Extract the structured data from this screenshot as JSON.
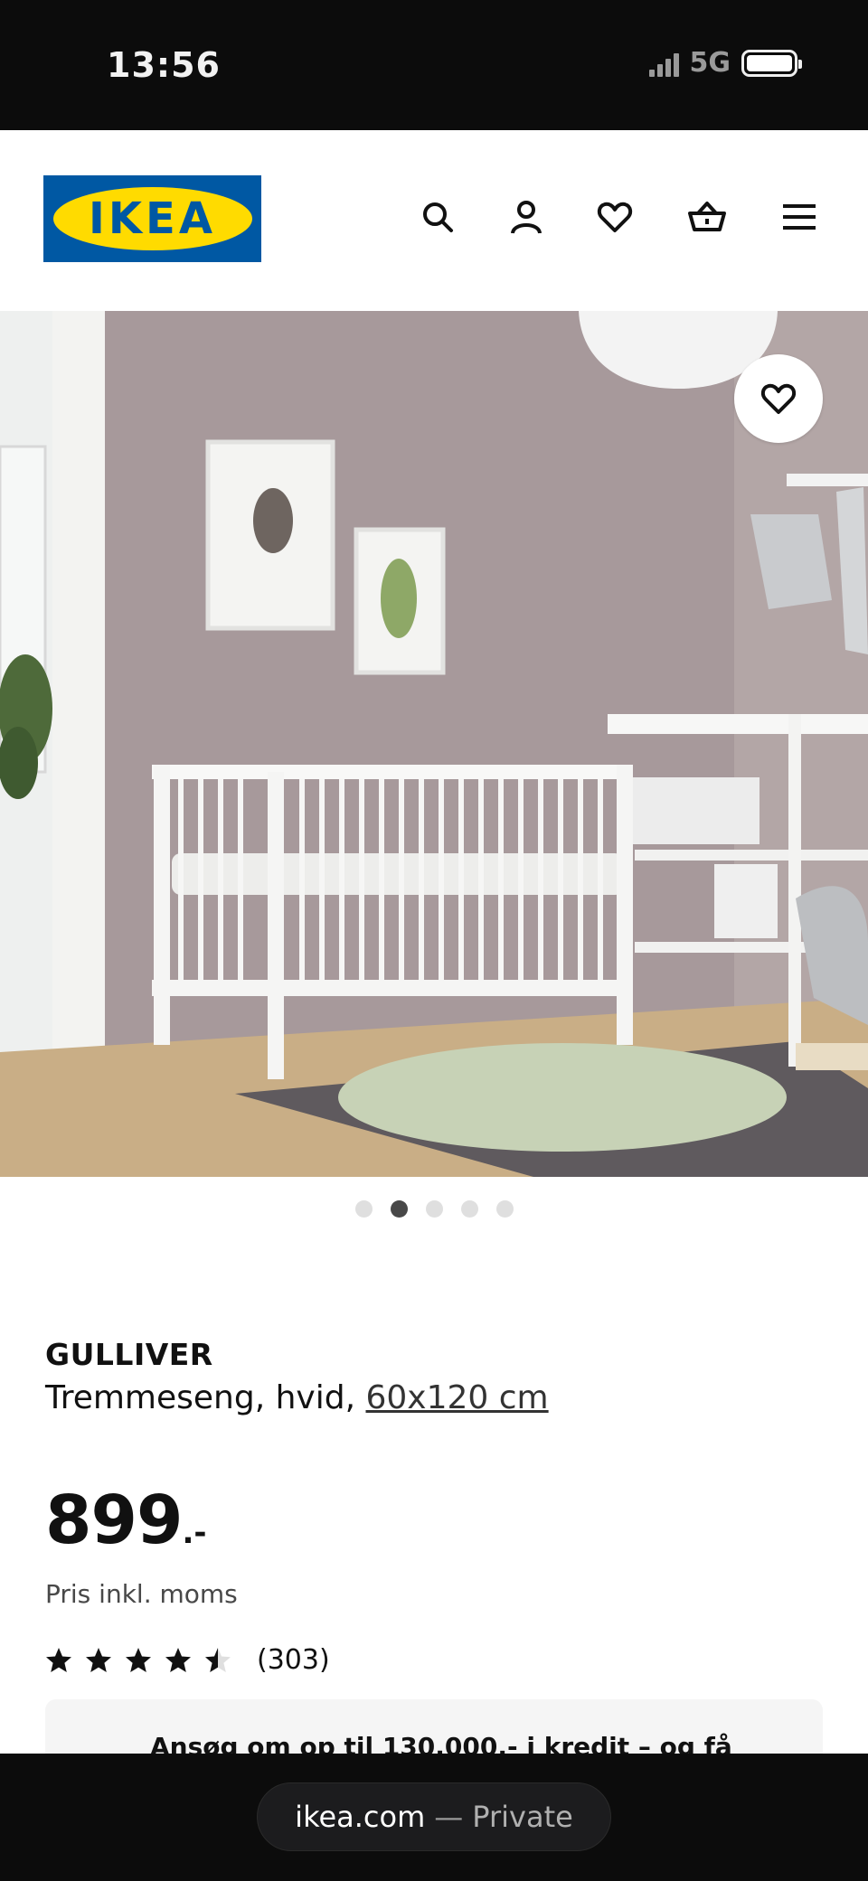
{
  "status_bar": {
    "time": "13:56",
    "network": "5G"
  },
  "header": {
    "logo_text": "IKEA",
    "icons": [
      "search-icon",
      "account-icon",
      "heart-icon",
      "basket-icon",
      "menu-icon"
    ]
  },
  "gallery": {
    "slide_count": 5,
    "active_slide": 2,
    "favorite_icon": "heart-icon"
  },
  "product": {
    "name": "GULLIVER",
    "description": "Tremmeseng, hvid,",
    "size_link": "60x120 cm",
    "price": "899",
    "price_suffix": ".-",
    "price_note": "Pris inkl. moms",
    "rating": 4.5,
    "review_count": "(303)"
  },
  "credit_banner": {
    "text": "Ansøg om op til 130.000,- i kredit – og få"
  },
  "browser": {
    "domain": "ikea.com",
    "separator": "—",
    "mode": "Private"
  },
  "colors": {
    "ikea_blue": "#0058a3",
    "ikea_yellow": "#ffdb00"
  }
}
